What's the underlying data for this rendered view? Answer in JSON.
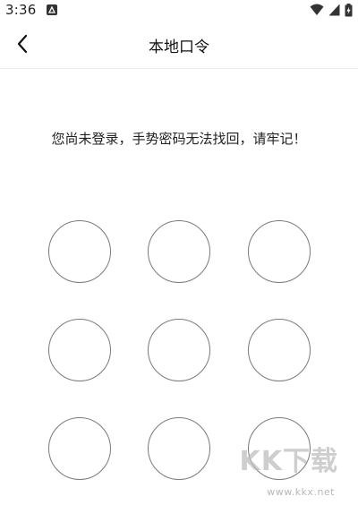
{
  "status_bar": {
    "time": "3:36",
    "icons": [
      "notification-app-icon",
      "wifi-icon",
      "cell-signal-icon",
      "battery-charging-icon"
    ]
  },
  "header": {
    "title": "本地口令",
    "back_icon": "chevron-left-icon"
  },
  "notice": {
    "text": "您尚未登录，手势密码无法找回，请牢记！"
  },
  "pattern": {
    "rows": 3,
    "columns": 3,
    "dots": [
      "1",
      "2",
      "3",
      "4",
      "5",
      "6",
      "7",
      "8",
      "9"
    ]
  },
  "watermark": {
    "brand": "KK下载",
    "url": "www.kkx.net"
  },
  "colors": {
    "background": "#ffffff",
    "text": "#111111",
    "circle_stroke": "#7a7a7a",
    "divider": "#ececec"
  }
}
